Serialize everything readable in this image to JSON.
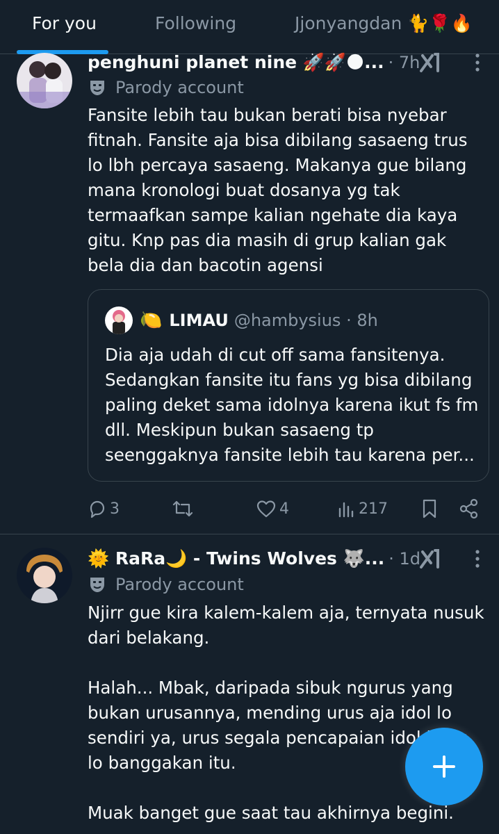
{
  "tabs": [
    {
      "label": "For you",
      "active": true
    },
    {
      "label": "Following",
      "active": false
    },
    {
      "label": "Jjonyangdan 🐈🌹🔥",
      "active": false
    }
  ],
  "posts": [
    {
      "display_name": "penghuni planet nine 🚀🚀🌑...",
      "meta": "· 7h",
      "parody_label": "Parody account",
      "text": "Fansite lebih tau bukan berati bisa nyebar fitnah. Fansite aja bisa dibilang sasaeng trus lo lbh percaya sasaeng. Makanya gue bilang mana kronologi buat dosanya yg tak termaafkan sampe kalian ngehate dia kaya gitu. Knp pas dia masih di grup kalian gak bela dia dan bacotin agensi",
      "quote": {
        "emoji": "🍋",
        "name": "LIMAU",
        "handle_time": "@hambysius · 8h",
        "text": "Dia aja udah di cut off sama fansitenya. Sedangkan fansite itu fans yg bisa dibilang paling deket sama idolnya karena ikut fs fm dll. Meskipun bukan sasaeng tp seenggaknya fansite lebih tau karena per..."
      },
      "actions": {
        "replies": "3",
        "reposts": "",
        "likes": "4",
        "views": "217"
      }
    },
    {
      "display_name": "🌞 RaRa🌙 - Twins Wolves 🐺...",
      "meta": "· 1d",
      "parody_label": "Parody account",
      "text": "Njirr gue kira kalem-kalem aja, ternyata nusuk dari belakang.\n\nHalah... Mbak, daripada sibuk ngurus yang bukan urusannya, mending urus aja idol lo sendiri ya, urus segala pencapaian idol lo yg lo banggakan itu.\n\nMuak banget gue saat tau akhirnya begini."
    }
  ],
  "colors": {
    "background": "#15202b",
    "accent": "#1d9bf0",
    "text": "#f7f9f9",
    "muted": "#8b98a5",
    "border": "#38444d"
  },
  "icons": {
    "parody": "mask-icon",
    "grok": "grok-icon",
    "more": "more-icon",
    "reply": "reply-icon",
    "repost": "repost-icon",
    "like": "heart-icon",
    "views": "views-icon",
    "bookmark": "bookmark-icon",
    "share": "share-icon",
    "compose": "plus-icon"
  }
}
